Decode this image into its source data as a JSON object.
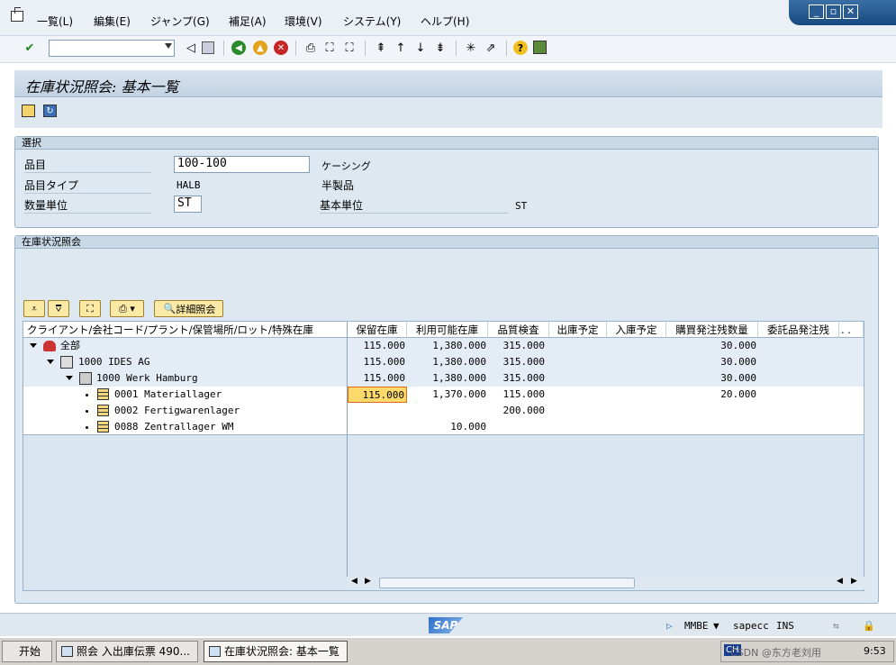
{
  "menu": {
    "items": [
      "一覧(L)",
      "編集(E)",
      "ジャンプ(G)",
      "補足(A)",
      "環境(V)",
      "システム(Y)",
      "ヘルプ(H)"
    ]
  },
  "window_controls": [
    "_",
    "▫",
    "✕"
  ],
  "title": "在庫状況照会: 基本一覧",
  "selection": {
    "header": "選択",
    "material_label": "品目",
    "material_value": "100-100",
    "material_desc": "ケーシング",
    "type_label": "品目タイプ",
    "type_value": "HALB",
    "type_desc": "半製品",
    "unit_label": "数量単位",
    "unit_value": "ST",
    "base_unit_label": "基本単位",
    "base_unit_value": "ST"
  },
  "overview": {
    "header": "在庫状況照会",
    "detail_button": "詳細照会",
    "columns": [
      "クライアント/会社コード/プラント/保管場所/ロット/特殊在庫",
      "保留在庫",
      "利用可能在庫",
      "品質検査",
      "出庫予定",
      "入庫予定",
      "購買発注残数量",
      "委託品発注残",
      ". ."
    ],
    "rows": [
      {
        "label": "全部",
        "blocked": "115.000",
        "unrestricted": "1,380.000",
        "quality": "315.000",
        "po": "30.000"
      },
      {
        "label": "1000 IDES AG",
        "blocked": "115.000",
        "unrestricted": "1,380.000",
        "quality": "315.000",
        "po": "30.000"
      },
      {
        "label": "1000 Werk Hamburg",
        "blocked": "115.000",
        "unrestricted": "1,380.000",
        "quality": "315.000",
        "po": "30.000"
      },
      {
        "label": "0001 Materiallager",
        "blocked": "115.000",
        "unrestricted": "1,370.000",
        "quality": "115.000",
        "po": "20.000"
      },
      {
        "label": "0002 Fertigwarenlager",
        "blocked": "",
        "unrestricted": "",
        "quality": "200.000",
        "po": ""
      },
      {
        "label": "0088 Zentrallager WM",
        "blocked": "",
        "unrestricted": "10.000",
        "quality": "",
        "po": ""
      }
    ]
  },
  "status": {
    "transaction": "MMBE",
    "system": "sapecc",
    "mode": "INS"
  },
  "taskbar": {
    "start": "开始",
    "task1": "照会 入出庫伝票 490...",
    "task2": "在庫状況照会: 基本一覧",
    "tray_lang": "CH",
    "clock": "9:53",
    "watermark": "CSDN @东方老刘用"
  }
}
